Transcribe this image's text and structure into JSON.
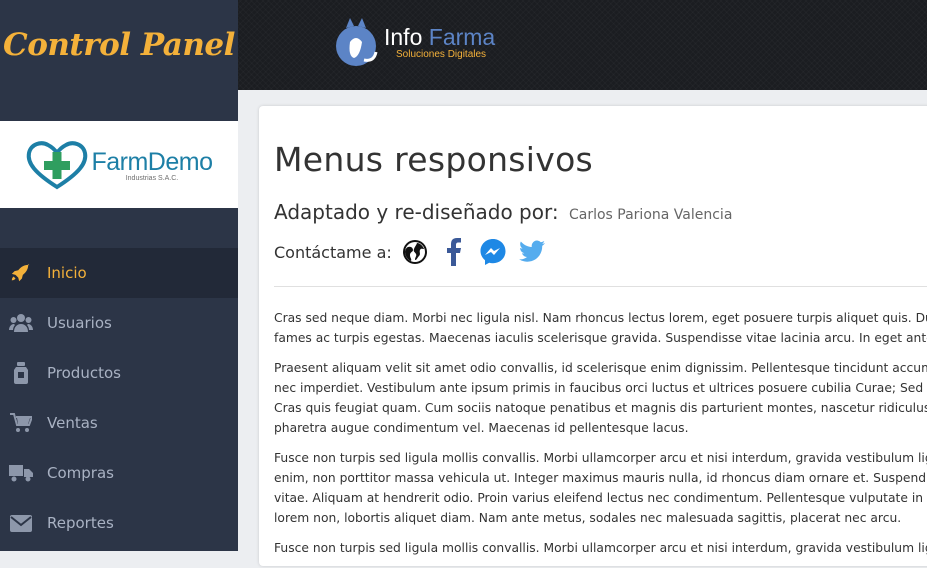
{
  "sidebar": {
    "brand_title": "Control Panel",
    "logo": {
      "name": "FarmDemo",
      "subtitle": "Industrias S.A.C."
    },
    "items": [
      {
        "label": "Inicio",
        "icon": "rocket-icon",
        "active": true
      },
      {
        "label": "Usuarios",
        "icon": "users-icon",
        "active": false
      },
      {
        "label": "Productos",
        "icon": "bottle-icon",
        "active": false
      },
      {
        "label": "Ventas",
        "icon": "cart-icon",
        "active": false
      },
      {
        "label": "Compras",
        "icon": "truck-icon",
        "active": false
      },
      {
        "label": "Reportes",
        "icon": "envelope-icon",
        "active": false
      }
    ]
  },
  "header": {
    "logo_name_a": "Info",
    "logo_name_b": "Farma",
    "logo_tagline": "Soluciones Digitales"
  },
  "main": {
    "title": "Menus responsivos",
    "subtitle_label": "Adaptado y re-diseñado por:",
    "author": "Carlos Pariona Valencia",
    "contact_label": "Contáctame a:",
    "social": [
      "globe-icon",
      "facebook-icon",
      "messenger-icon",
      "twitter-icon"
    ],
    "paragraphs": [
      [
        "Cras sed neque diam. Morbi nec ligula nisl. Nam rhoncus lectus lorem, eget posuere turpis aliquet quis. Du",
        "fames ac turpis egestas. Maecenas iaculis scelerisque gravida. Suspendisse vitae lacinia arcu. In eget ante"
      ],
      [
        "Praesent aliquam velit sit amet odio convallis, id scelerisque enim dignissim. Pellentesque tincidunt accumsar",
        "nec imperdiet. Vestibulum ante ipsum primis in faucibus orci luctus et ultrices posuere cubilia Curae; Sed sec",
        "Cras quis feugiat quam. Cum sociis natoque penatibus et magnis dis parturient montes, nascetur ridiculus",
        "pharetra augue condimentum vel. Maecenas id pellentesque lacus."
      ],
      [
        "Fusce non turpis sed ligula mollis convallis. Morbi ullamcorper arcu et nisi interdum, gravida vestibulum ligu",
        "enim, non porttitor massa vehicula ut. Integer maximus mauris nulla, id rhoncus diam ornare et. Suspendis",
        "vitae. Aliquam at hendrerit odio. Proin varius eleifend lectus nec condimentum. Pellentesque vulputate in ser",
        "lorem non, lobortis aliquet diam. Nam ante metus, sodales nec malesuada sagittis, placerat nec arcu."
      ],
      [
        "Fusce non turpis sed ligula mollis convallis. Morbi ullamcorper arcu et nisi interdum, gravida vestibulum ligu"
      ]
    ]
  },
  "colors": {
    "accent": "#f4b13a",
    "sidebar": "#2c3547",
    "sidebar_active": "#222938",
    "brand_blue": "#1d7fa6"
  }
}
